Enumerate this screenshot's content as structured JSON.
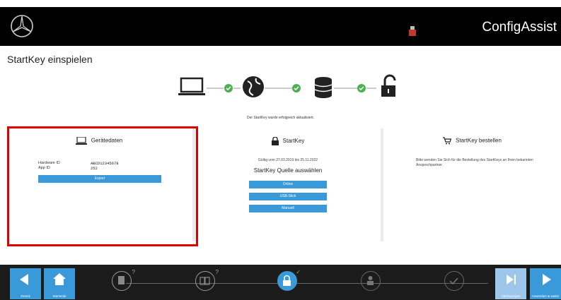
{
  "header": {
    "brand": "ConfigAssist"
  },
  "page": {
    "title": "StartKey einspielen"
  },
  "status": {
    "message": "Der StartKey wurde erfolgreich aktualisiert."
  },
  "panels": {
    "device": {
      "title": "Gerätedaten",
      "hardware_id_label": "Hardware ID",
      "hardware_id_value": "ABCD12345678",
      "app_id_label": "App ID",
      "app_id_value": "252",
      "export_label": "Export"
    },
    "startkey": {
      "title": "StartKey",
      "validity": "Gültig vom 27.03.2019 bis 25.11.2022",
      "source_heading": "StartKey Quelle auswählen",
      "buttons": [
        "Online",
        "USB-Stick",
        "Manuell"
      ]
    },
    "order": {
      "title": "StartKey bestellen",
      "info": "Bitte wenden Sie Sich für die Bestellung des StartKeys an Ihren bekannten Ansprechpartner."
    }
  },
  "bottom_bar": {
    "back_label": "Zurück",
    "home_label": "Startseite",
    "skip_label": "Überspringen",
    "apply_label": "Anwenden & weiter"
  },
  "colors": {
    "accent": "#3a9ad9",
    "success": "#4caf50",
    "header": "#000000",
    "highlight": "#e00000"
  }
}
